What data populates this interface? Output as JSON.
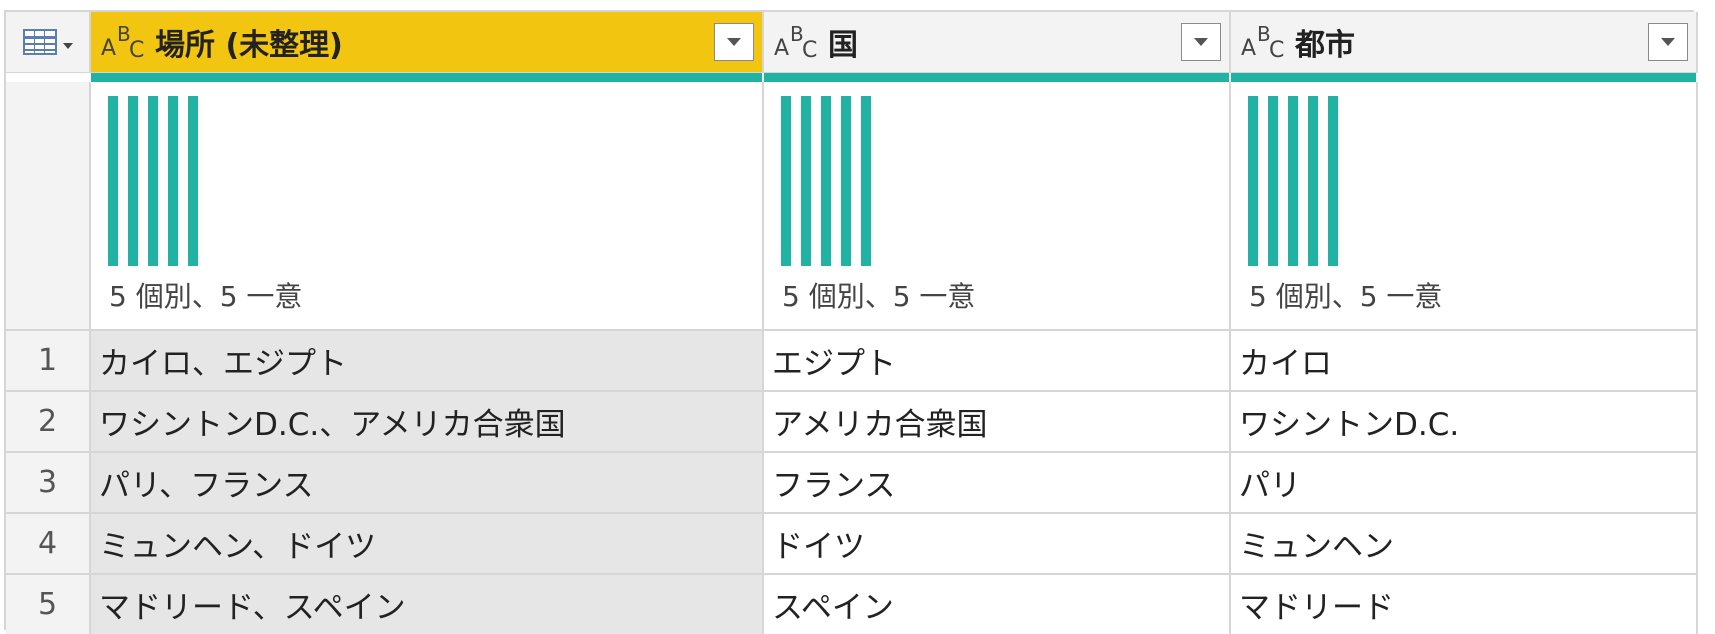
{
  "columns": [
    {
      "title": "場所 (未整理)",
      "selected": true,
      "profile": "5 個別、5 一意"
    },
    {
      "title": "国",
      "selected": false,
      "profile": "5 個別、5 一意"
    },
    {
      "title": "都市",
      "selected": false,
      "profile": "5 個別、5 一意"
    }
  ],
  "type_icon": {
    "a": "A",
    "b": "B",
    "c": "C"
  },
  "rows": [
    {
      "num": "1",
      "cells": [
        "カイロ、エジプト",
        "エジプト",
        "カイロ"
      ]
    },
    {
      "num": "2",
      "cells": [
        "ワシントンD.C.、アメリカ合衆国",
        "アメリカ合衆国",
        "ワシントンD.C."
      ]
    },
    {
      "num": "3",
      "cells": [
        "パリ、フランス",
        "フランス",
        "パリ"
      ]
    },
    {
      "num": "4",
      "cells": [
        "ミュンヘン、ドイツ",
        "ドイツ",
        "ミュンヘン"
      ]
    },
    {
      "num": "5",
      "cells": [
        "マドリード、スペイン",
        "スペイン",
        "マドリード"
      ]
    }
  ],
  "colors": {
    "selected_header": "#f2c511",
    "quality_bar": "#20b2a2",
    "distribution_bar": "#20b2a2"
  }
}
